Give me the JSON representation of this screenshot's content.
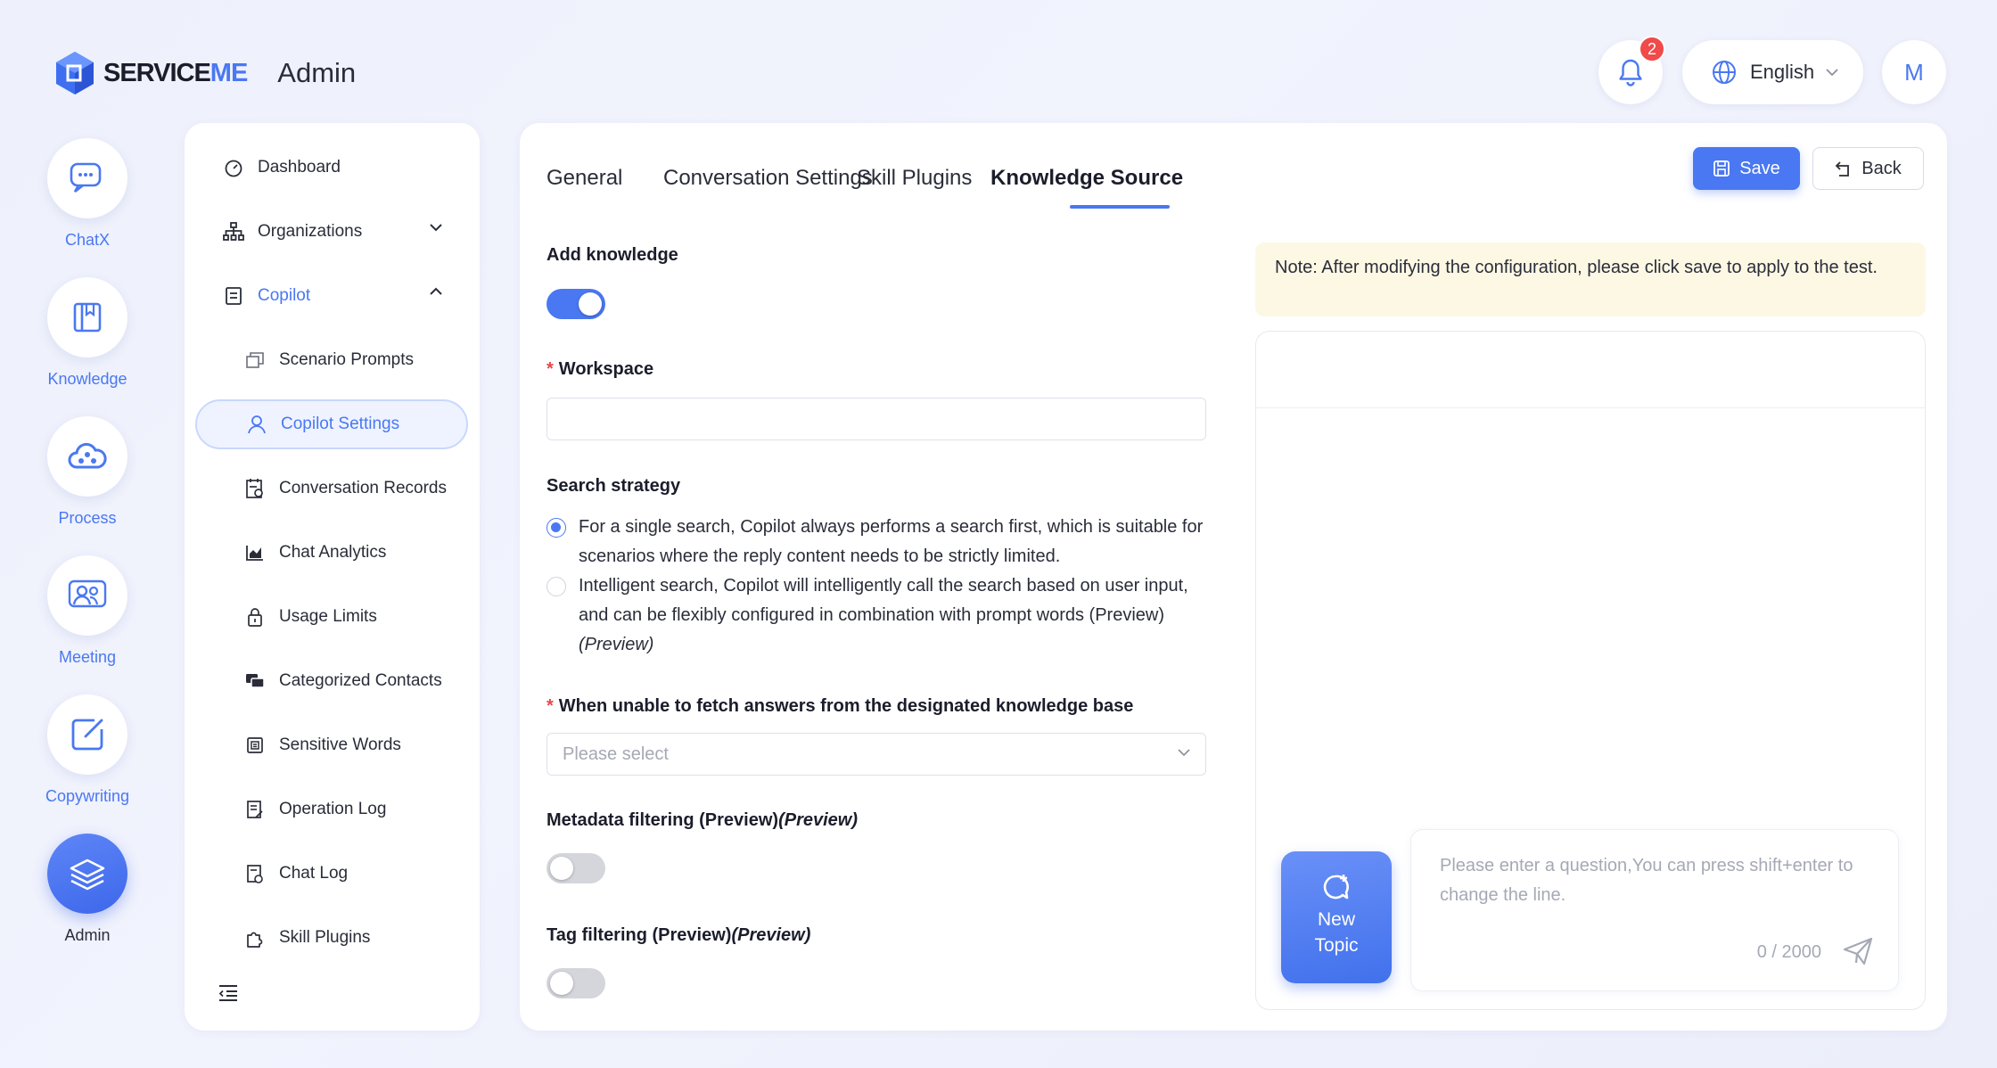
{
  "header": {
    "brand_prefix": "SERVICE",
    "brand_suffix": "ME",
    "section_title": "Admin",
    "notification_count": "2",
    "language": "English",
    "avatar_initial": "M"
  },
  "rail": {
    "items": [
      {
        "label": "ChatX",
        "icon": "chat-bubble-icon"
      },
      {
        "label": "Knowledge",
        "icon": "book-icon"
      },
      {
        "label": "Process",
        "icon": "cloud-flow-icon"
      },
      {
        "label": "Meeting",
        "icon": "people-icon"
      },
      {
        "label": "Copywriting",
        "icon": "edit-icon"
      },
      {
        "label": "Admin",
        "icon": "layers-icon",
        "active": true
      }
    ]
  },
  "nav": {
    "items": [
      {
        "label": "Dashboard",
        "icon": "dashboard-icon"
      },
      {
        "label": "Organizations",
        "icon": "org-tree-icon",
        "expandable": true
      },
      {
        "label": "Copilot",
        "icon": "copilot-icon",
        "expanded": true
      },
      {
        "label": "Scenario Prompts",
        "icon": "prompts-icon"
      },
      {
        "label": "Copilot Settings",
        "icon": "user-settings-icon",
        "active": true
      },
      {
        "label": "Conversation Records",
        "icon": "records-icon"
      },
      {
        "label": "Chat Analytics",
        "icon": "analytics-icon"
      },
      {
        "label": "Usage Limits",
        "icon": "lock-icon"
      },
      {
        "label": "Categorized Contacts",
        "icon": "contacts-icon"
      },
      {
        "label": "Sensitive Words",
        "icon": "sensitive-words-icon"
      },
      {
        "label": "Operation Log",
        "icon": "operation-log-icon"
      },
      {
        "label": "Chat Log",
        "icon": "chat-log-icon"
      },
      {
        "label": "Skill Plugins",
        "icon": "plugin-icon"
      }
    ]
  },
  "tabs": [
    {
      "label": "General"
    },
    {
      "label": "Conversation Settings"
    },
    {
      "label": "Skill Plugins"
    },
    {
      "label": "Knowledge Source",
      "active": true
    }
  ],
  "actions": {
    "save": "Save",
    "back": "Back"
  },
  "form": {
    "add_knowledge": {
      "label": "Add knowledge",
      "enabled": true
    },
    "workspace": {
      "label": "Workspace",
      "required": true,
      "value": ""
    },
    "search_strategy": {
      "label": "Search strategy",
      "options": [
        {
          "text": "For a single search, Copilot always performs a search first, which is suitable for scenarios where the reply content needs to be strictly limited.",
          "suffix": "",
          "selected": true
        },
        {
          "text": "Intelligent search, Copilot will intelligently call the search based on user input, and can be flexibly configured in combination with prompt words (Preview)",
          "suffix": "(Preview)",
          "selected": false
        }
      ]
    },
    "fallback": {
      "label": "When unable to fetch answers from the designated knowledge base",
      "required": true,
      "placeholder": "Please select"
    },
    "metadata_filtering": {
      "label": "Metadata filtering (Preview)",
      "suffix": "(Preview)",
      "enabled": false
    },
    "tag_filtering": {
      "label": "Tag filtering (Preview)",
      "suffix": "(Preview)",
      "enabled": false
    }
  },
  "test_panel": {
    "note": "Note: After modifying the configuration, please click save to apply to the test.",
    "new_topic_line1": "New",
    "new_topic_line2": "Topic",
    "input_placeholder": "Please enter a question,You can press shift+enter to change the line.",
    "char_count": "0 / 2000"
  },
  "colors": {
    "accent": "#4a78f2",
    "note_bg": "#fdf8e4",
    "badge": "#f04a4a"
  }
}
